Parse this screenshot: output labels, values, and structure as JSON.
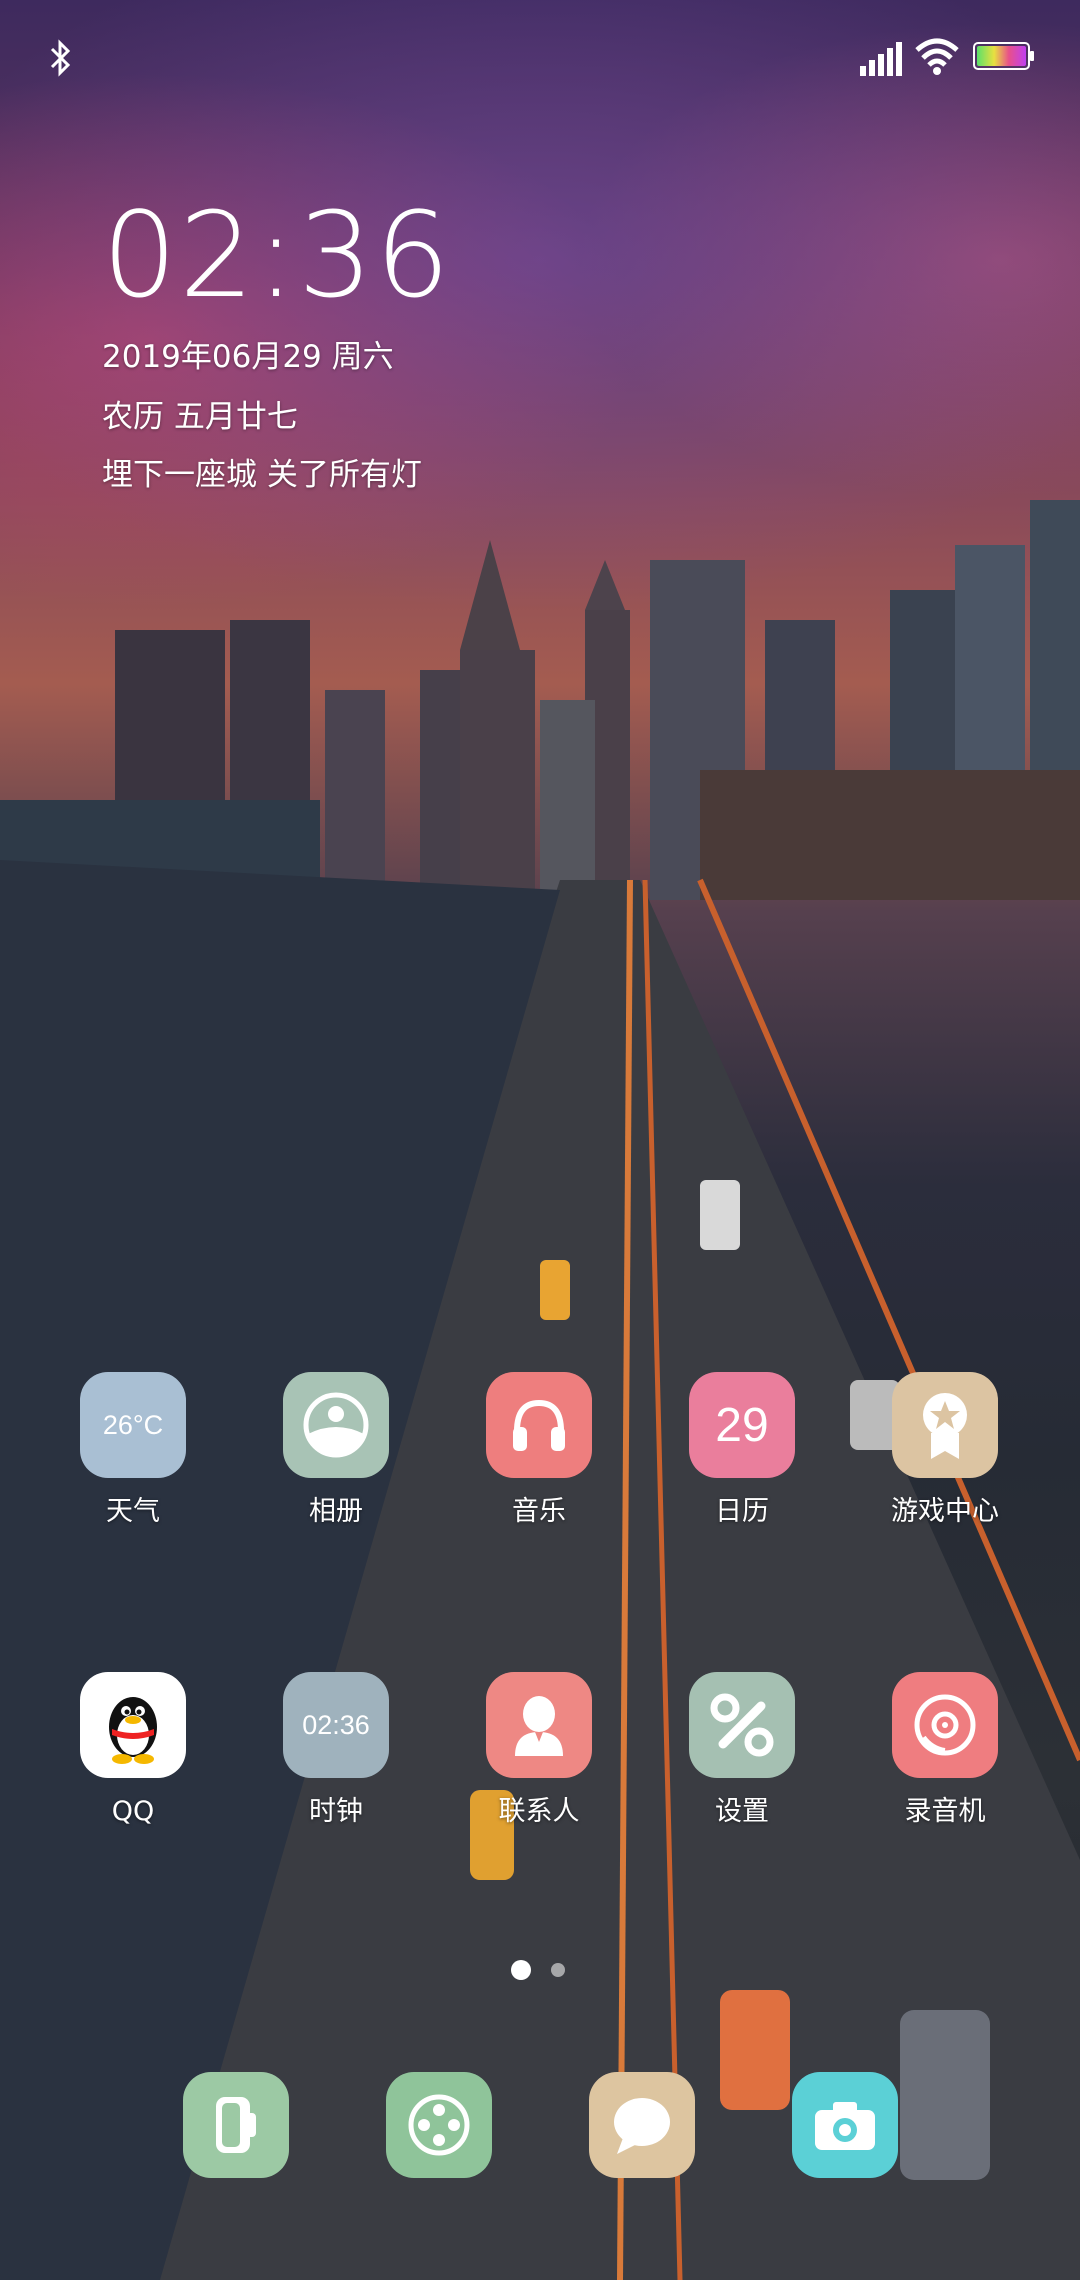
{
  "status_bar": {
    "icons": [
      "bluetooth-icon",
      "signal-icon",
      "wifi-icon",
      "battery-icon"
    ]
  },
  "lock_widget": {
    "time": "02:36",
    "date": "2019年06月29 周六",
    "lunar": "农历 五月廿七",
    "motto": "埋下一座城 关了所有灯"
  },
  "apps_row1": [
    {
      "label": "天气",
      "icon": "weather-icon",
      "icon_text": "26°C",
      "color": "#a9bfd3"
    },
    {
      "label": "相册",
      "icon": "gallery-icon",
      "icon_text": "",
      "color": "#a8c3b5"
    },
    {
      "label": "音乐",
      "icon": "headphones-icon",
      "icon_text": "",
      "color": "#ee7e7e"
    },
    {
      "label": "日历",
      "icon": "calendar-icon",
      "icon_text": "29",
      "color": "#ea7e9c"
    },
    {
      "label": "游戏中心",
      "icon": "game-badge-icon",
      "icon_text": "",
      "color": "#dcc4a2"
    }
  ],
  "apps_row2": [
    {
      "label": "QQ",
      "icon": "qq-penguin-icon",
      "icon_text": "",
      "color": "#ffffff"
    },
    {
      "label": "时钟",
      "icon": "clock-icon",
      "icon_text": "02:36",
      "color": "#9fb2bd"
    },
    {
      "label": "联系人",
      "icon": "contact-person-icon",
      "icon_text": "",
      "color": "#ee8884"
    },
    {
      "label": "设置",
      "icon": "settings-tools-icon",
      "icon_text": "",
      "color": "#a5c0b2"
    },
    {
      "label": "录音机",
      "icon": "recorder-icon",
      "icon_text": "",
      "color": "#ef7d80"
    }
  ],
  "page_indicator": {
    "pages": 2,
    "current": 1
  },
  "dock": [
    {
      "icon": "phone-icon",
      "color": "#9cc9a4"
    },
    {
      "icon": "browser-icon",
      "color": "#8fc49a"
    },
    {
      "icon": "messages-icon",
      "color": "#ddc5a0"
    },
    {
      "icon": "camera-icon",
      "color": "#5bd0d6"
    }
  ]
}
